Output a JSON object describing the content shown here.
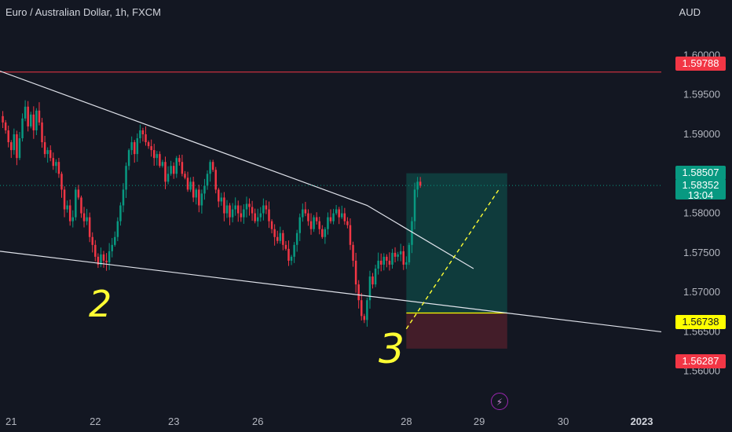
{
  "header": {
    "symbol_title": "Euro / Australian Dollar, 1h, FXCM",
    "currency": "AUD"
  },
  "price_tags": {
    "resistance": "1.59788",
    "target": "1.58507",
    "last_price": "1.58352",
    "countdown": "13:04",
    "entry": "1.56738",
    "stop": "1.56287"
  },
  "icons": {
    "bolt": "lightning-icon"
  },
  "colors": {
    "background": "#131722",
    "up": "#089981",
    "down": "#f23645",
    "trendline": "#e0e3eb",
    "annotation": "#ffff33",
    "resistance": "#f23645"
  },
  "chart_data": {
    "type": "candlestick",
    "symbol": "Euro / Australian Dollar",
    "timeframe": "1h",
    "ylim": [
      1.5555,
      1.607
    ],
    "y_ticks": [
      1.56,
      1.565,
      1.57,
      1.575,
      1.58,
      1.585,
      1.59,
      1.595,
      1.6
    ],
    "y_tick_labels": [
      "1.56000",
      "1.56500",
      "1.57000",
      "1.57500",
      "1.58000",
      "1.58500",
      "1.59000",
      "1.59500",
      "1.60000"
    ],
    "x_ticks": [
      "21",
      "22",
      "23",
      "26",
      "28",
      "29",
      "30",
      "2023"
    ],
    "x_tick_index": [
      3,
      33,
      61,
      91,
      144,
      170,
      200,
      228
    ],
    "x_range": [
      -1,
      235
    ],
    "grid": false,
    "close_series": [
      1.5915,
      1.5905,
      1.589,
      1.588,
      1.59,
      1.587,
      1.5895,
      1.592,
      1.5935,
      1.591,
      1.5925,
      1.5905,
      1.593,
      1.5915,
      1.589,
      1.5875,
      1.588,
      1.587,
      1.586,
      1.5865,
      1.585,
      1.583,
      1.5805,
      1.581,
      1.579,
      1.5795,
      1.583,
      1.582,
      1.58,
      1.579,
      1.5795,
      1.577,
      1.576,
      1.5745,
      1.5735,
      1.5748,
      1.574,
      1.5738,
      1.5752,
      1.576,
      1.577,
      1.579,
      1.581,
      1.583,
      1.586,
      1.588,
      1.589,
      1.5875,
      1.5895,
      1.5905,
      1.59,
      1.589,
      1.5885,
      1.588,
      1.587,
      1.5875,
      1.586,
      1.5865,
      1.584,
      1.585,
      1.586,
      1.585,
      1.587,
      1.5865,
      1.585,
      1.5845,
      1.583,
      1.584,
      1.582,
      1.583,
      1.581,
      1.5825,
      1.5835,
      1.585,
      1.5865,
      1.5855,
      1.583,
      1.5815,
      1.582,
      1.58,
      1.581,
      1.5795,
      1.5805,
      1.581,
      1.58,
      1.5795,
      1.5805,
      1.5812,
      1.5808,
      1.58,
      1.579,
      1.5795,
      1.58,
      1.581,
      1.5805,
      1.579,
      1.578,
      1.577,
      1.5765,
      1.5775,
      1.576,
      1.5755,
      1.574,
      1.5745,
      1.576,
      1.5775,
      1.5795,
      1.5805,
      1.58,
      1.579,
      1.578,
      1.5795,
      1.579,
      1.578,
      1.577,
      1.578,
      1.5795,
      1.579,
      1.58,
      1.5805,
      1.5795,
      1.58,
      1.579,
      1.5785,
      1.576,
      1.574,
      1.571,
      1.569,
      1.567,
      1.5665,
      1.569,
      1.572,
      1.571,
      1.573,
      1.574,
      1.5735,
      1.5745,
      1.574,
      1.5735,
      1.575,
      1.5745,
      1.5748,
      1.5752,
      1.5735,
      1.5738,
      1.576,
      1.579,
      1.583,
      1.584,
      1.5835
    ],
    "annotations": [
      {
        "type": "trendline",
        "points": [
          [
            -1,
            1.598
          ],
          [
            130,
            1.581
          ],
          [
            168,
            1.573
          ]
        ]
      },
      {
        "type": "trendline",
        "points": [
          [
            -1,
            1.5752
          ],
          [
            235,
            1.565
          ]
        ]
      },
      {
        "type": "horizontal",
        "value": 1.59788,
        "label": "1.59788"
      },
      {
        "type": "long_position",
        "entry": 1.56738,
        "target": 1.58507,
        "stop": 1.56287
      },
      {
        "type": "text",
        "text": "2"
      },
      {
        "type": "text",
        "text": "3"
      }
    ],
    "last_price": 1.58352
  }
}
